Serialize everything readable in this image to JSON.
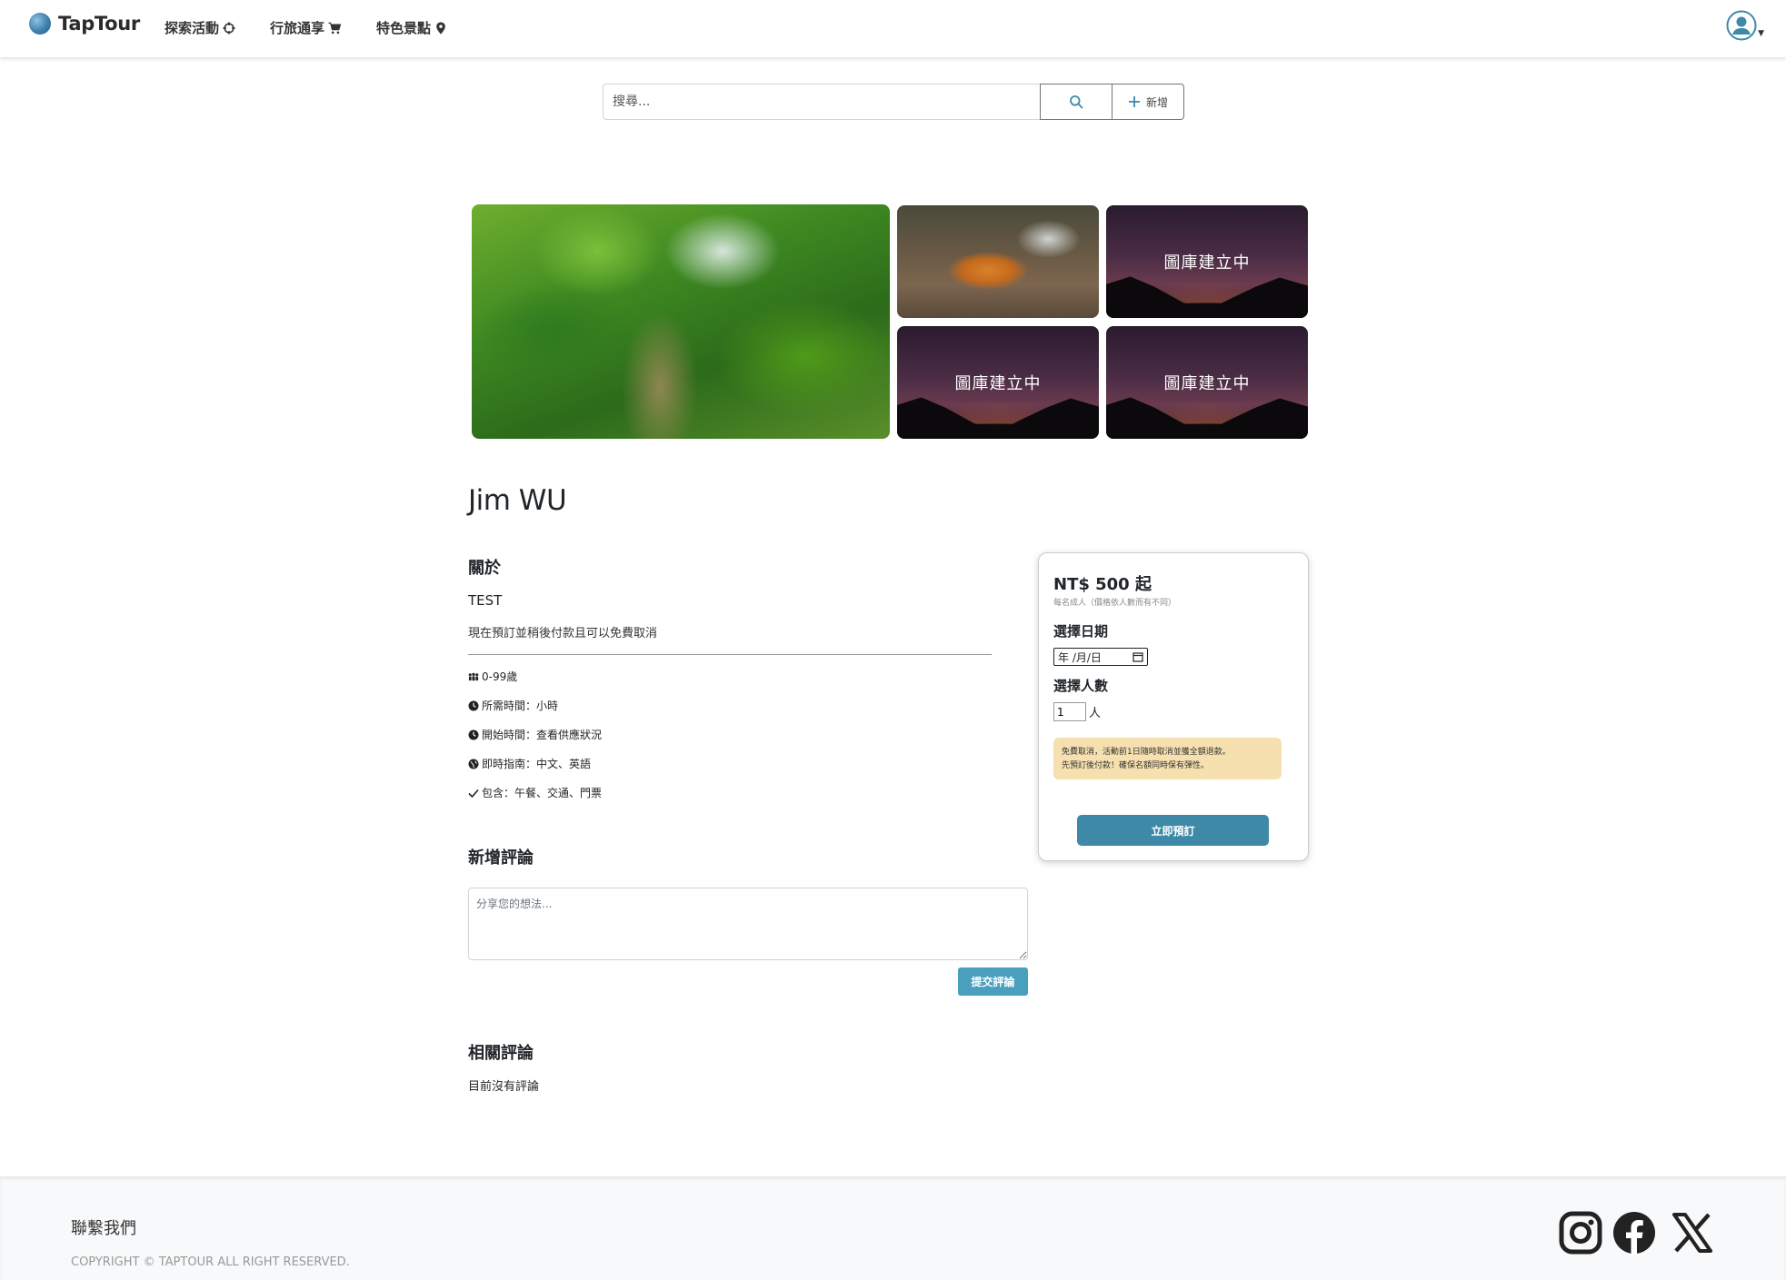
{
  "navbar": {
    "brand": "TapTour",
    "items": [
      {
        "label": "探索活動",
        "icon": "crosshair-icon"
      },
      {
        "label": "行旅通享",
        "icon": "cart-icon"
      },
      {
        "label": "特色景點",
        "icon": "map-pin-icon"
      }
    ],
    "user_icon": "user-circle-icon",
    "colors": {
      "accent": "#3e89a8"
    }
  },
  "search": {
    "placeholder": "搜尋...",
    "add_label": "新增"
  },
  "gallery": {
    "placeholder_label": "圖庫建立中"
  },
  "activity": {
    "title": "Jim WU",
    "about_heading": "關於",
    "about_text": "TEST",
    "about_note": "現在預訂並稍後付款且可以免費取消",
    "info": [
      {
        "icon": "people-icon",
        "text": "0-99歲"
      },
      {
        "icon": "clock-icon",
        "text": "所需時間：小時"
      },
      {
        "icon": "clock-icon",
        "text": "開始時間：查看供應狀況"
      },
      {
        "icon": "globe-icon",
        "text": "即時指南：中文、英語"
      },
      {
        "icon": "check-icon",
        "text": "包含：午餐、交通、門票"
      }
    ]
  },
  "review_form": {
    "heading": "新增評論",
    "placeholder": "分享您的想法...",
    "submit_label": "提交評論"
  },
  "reviews": {
    "heading": "相關評論",
    "empty_text": "目前沒有評論"
  },
  "booking": {
    "price": "NT$ 500 起",
    "price_note": "每名成人（價格依人數而有不同）",
    "date_label": "選擇日期",
    "date_value": "年 /月/日",
    "people_label": "選擇人數",
    "people_value": "1",
    "people_unit": "人",
    "notice_line1": "免費取消，活動前1日隨時取消並獲全額退款。",
    "notice_line2": "先預訂後付款！確保名額同時保有彈性。",
    "book_label": "立即預訂"
  },
  "footer": {
    "title": "聯繫我們",
    "copyright": "COPYRIGHT © TAPTOUR ALL RIGHT RESERVED.",
    "social": [
      "instagram-icon",
      "facebook-icon",
      "x-icon"
    ]
  }
}
